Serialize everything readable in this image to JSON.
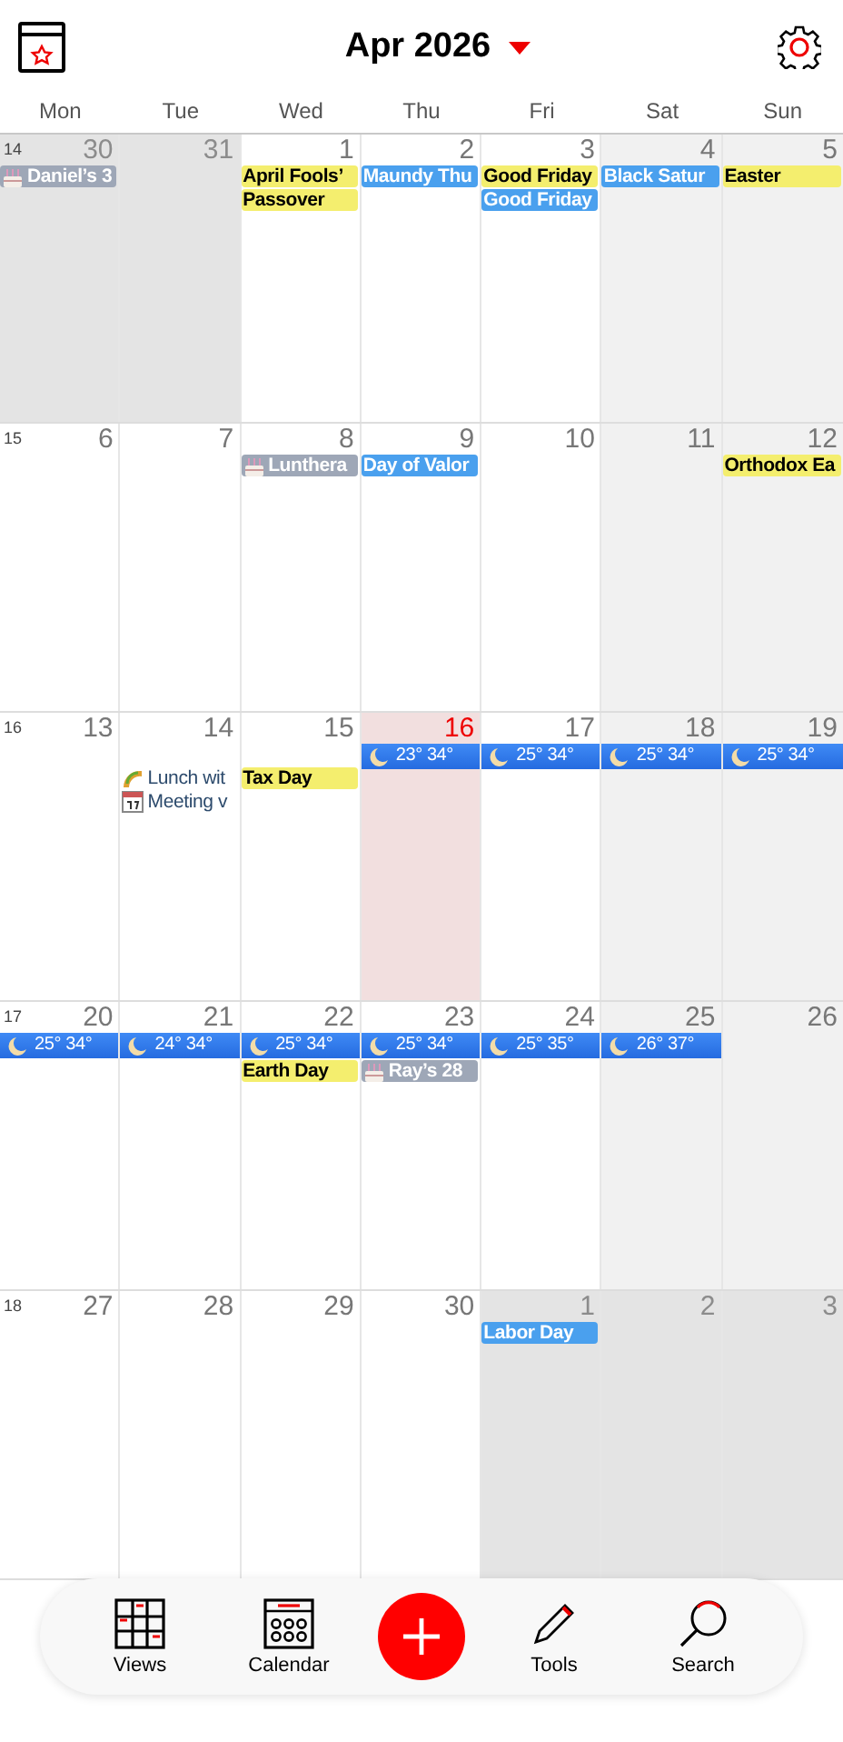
{
  "header": {
    "title": "Apr 2026"
  },
  "weekdays": [
    "Mon",
    "Tue",
    "Wed",
    "Thu",
    "Fri",
    "Sat",
    "Sun"
  ],
  "weeks": [
    {
      "number": "14",
      "days": [
        {
          "date": "30",
          "kind": "other",
          "events": [
            {
              "kind": "birthday",
              "text": "Daniel’s 3"
            }
          ]
        },
        {
          "date": "31",
          "kind": "other"
        },
        {
          "date": "1",
          "kind": "weekday",
          "events": [
            {
              "kind": "holiday",
              "text": "April Fools’"
            },
            {
              "kind": "holiday",
              "text": "Passover"
            }
          ]
        },
        {
          "date": "2",
          "kind": "weekday",
          "events": [
            {
              "kind": "observance",
              "text": "Maundy Thu"
            }
          ]
        },
        {
          "date": "3",
          "kind": "weekday",
          "events": [
            {
              "kind": "holiday",
              "text": "Good Friday"
            },
            {
              "kind": "observance",
              "text": "Good Friday"
            }
          ]
        },
        {
          "date": "4",
          "kind": "weekend",
          "events": [
            {
              "kind": "observance",
              "text": "Black Satur"
            }
          ]
        },
        {
          "date": "5",
          "kind": "weekend",
          "events": [
            {
              "kind": "holiday",
              "text": "Easter"
            }
          ]
        }
      ]
    },
    {
      "number": "15",
      "days": [
        {
          "date": "6",
          "kind": "weekday"
        },
        {
          "date": "7",
          "kind": "weekday"
        },
        {
          "date": "8",
          "kind": "weekday",
          "events": [
            {
              "kind": "birthday",
              "text": "Lunthera"
            }
          ]
        },
        {
          "date": "9",
          "kind": "weekday",
          "events": [
            {
              "kind": "observance",
              "text": "Day of Valor"
            }
          ]
        },
        {
          "date": "10",
          "kind": "weekday"
        },
        {
          "date": "11",
          "kind": "weekend"
        },
        {
          "date": "12",
          "kind": "weekend",
          "events": [
            {
              "kind": "holiday",
              "text": "Orthodox Ea"
            }
          ]
        }
      ]
    },
    {
      "number": "16",
      "days": [
        {
          "date": "13",
          "kind": "weekday"
        },
        {
          "date": "14",
          "kind": "weekday",
          "events": [
            {
              "kind": "lunch",
              "text": "Lunch wit"
            },
            {
              "kind": "meeting",
              "text": "Meeting v"
            }
          ]
        },
        {
          "date": "15",
          "kind": "weekday",
          "events": [
            {
              "kind": "holiday",
              "text": "Tax Day"
            }
          ]
        },
        {
          "date": "16",
          "kind": "today",
          "events": [
            {
              "kind": "weather",
              "text": "23° 34°"
            }
          ]
        },
        {
          "date": "17",
          "kind": "weekday",
          "events": [
            {
              "kind": "weather",
              "text": "25° 34°"
            }
          ]
        },
        {
          "date": "18",
          "kind": "weekend",
          "events": [
            {
              "kind": "weather",
              "text": "25° 34°"
            }
          ]
        },
        {
          "date": "19",
          "kind": "weekend",
          "events": [
            {
              "kind": "weather",
              "text": "25° 34°"
            }
          ]
        }
      ]
    },
    {
      "number": "17",
      "days": [
        {
          "date": "20",
          "kind": "weekday",
          "events": [
            {
              "kind": "weather",
              "text": "25° 34°"
            }
          ]
        },
        {
          "date": "21",
          "kind": "weekday",
          "events": [
            {
              "kind": "weather",
              "text": "24° 34°"
            }
          ]
        },
        {
          "date": "22",
          "kind": "weekday",
          "events": [
            {
              "kind": "weather",
              "text": "25° 34°"
            },
            {
              "kind": "holiday",
              "text": "Earth Day"
            }
          ]
        },
        {
          "date": "23",
          "kind": "weekday",
          "events": [
            {
              "kind": "weather",
              "text": "25° 34°"
            },
            {
              "kind": "birthday",
              "text": "Ray’s 28"
            }
          ]
        },
        {
          "date": "24",
          "kind": "weekday",
          "events": [
            {
              "kind": "weather",
              "text": "25° 35°"
            }
          ]
        },
        {
          "date": "25",
          "kind": "weekend",
          "events": [
            {
              "kind": "weather",
              "text": "26° 37°"
            }
          ]
        },
        {
          "date": "26",
          "kind": "weekend"
        }
      ]
    },
    {
      "number": "18",
      "days": [
        {
          "date": "27",
          "kind": "weekday"
        },
        {
          "date": "28",
          "kind": "weekday"
        },
        {
          "date": "29",
          "kind": "weekday"
        },
        {
          "date": "30",
          "kind": "weekday"
        },
        {
          "date": "1",
          "kind": "other",
          "events": [
            {
              "kind": "observance",
              "text": "Labor Day"
            }
          ]
        },
        {
          "date": "2",
          "kind": "other"
        },
        {
          "date": "3",
          "kind": "other"
        }
      ]
    }
  ],
  "toolbar": [
    {
      "kind": "views",
      "label": "Views"
    },
    {
      "kind": "calendar",
      "label": "Calendar"
    },
    {
      "kind": "add"
    },
    {
      "kind": "tools",
      "label": "Tools"
    },
    {
      "kind": "search",
      "label": "Search"
    }
  ]
}
